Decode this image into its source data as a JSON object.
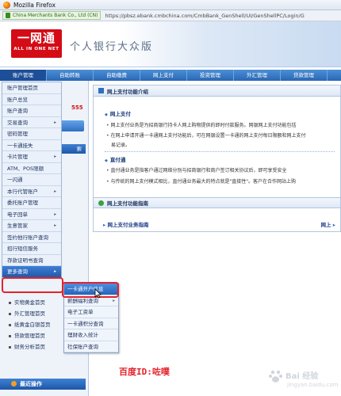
{
  "browser": {
    "window_title": "Mozilla Firefox",
    "site_identity": "China Merchants Bank Co., Ltd (CN)",
    "url": "https://pbsz.ebank.cmbchina.com/CmbBank_GenShell/UI/GenShellPC/Login/G"
  },
  "bank": {
    "logo_cn": "一网通",
    "logo_en": "ALL IN ONE NET",
    "title": "个人银行大众版"
  },
  "topnav": {
    "tabs": [
      {
        "label": "账户管理"
      },
      {
        "label": "自助转账"
      },
      {
        "label": "自助缴费"
      },
      {
        "label": "网上支付"
      },
      {
        "label": "投资管理"
      },
      {
        "label": "外汇管理"
      },
      {
        "label": "贷款管理"
      }
    ]
  },
  "left": {
    "red_digits": "555",
    "collapse_label": "索"
  },
  "menu": {
    "items": [
      {
        "label": "账户管理首页",
        "has_sub": false
      },
      {
        "label": "账户总览",
        "has_sub": false
      },
      {
        "label": "账户查询",
        "has_sub": false
      },
      {
        "label": "交易查询",
        "has_sub": true
      },
      {
        "label": "密码管理",
        "has_sub": false
      },
      {
        "label": "一卡通挂失",
        "has_sub": false
      },
      {
        "label": "卡片管理",
        "has_sub": true
      },
      {
        "label": "ATM、POS限额",
        "has_sub": false
      },
      {
        "label": "一闪通",
        "has_sub": false
      },
      {
        "label": "本行代管账户",
        "has_sub": true
      },
      {
        "label": "委托账户管理",
        "has_sub": false
      },
      {
        "label": "电子回单",
        "has_sub": true
      },
      {
        "label": "生意管家",
        "has_sub": true
      },
      {
        "label": "签约他行账户查询",
        "has_sub": false
      },
      {
        "label": "招行短信服务",
        "has_sub": false
      },
      {
        "label": "存款证明书查询",
        "has_sub": false
      },
      {
        "label": "更多查询",
        "has_sub": true
      }
    ],
    "highlighted": "更多查询"
  },
  "subtree": {
    "items": [
      {
        "label": "实物黄金首页"
      },
      {
        "label": "外汇管理首页"
      },
      {
        "label": "纸黄金白银首页"
      },
      {
        "label": "贷款管理首页"
      },
      {
        "label": "财务分析首页"
      }
    ],
    "recent_label": "最近操作"
  },
  "submenu": {
    "items": [
      {
        "label": "一卡通开户信息",
        "has_sub": false
      },
      {
        "label": "薪酬福利查询",
        "has_sub": true
      },
      {
        "label": "电子工资单",
        "has_sub": false
      },
      {
        "label": "一卡通积分查询",
        "has_sub": false
      },
      {
        "label": "理财收入统计",
        "has_sub": false
      },
      {
        "label": "社保账户查询",
        "has_sub": false
      }
    ],
    "highlighted": "一卡通开户信息"
  },
  "panel": {
    "title": "网上支付功能介绍",
    "section1_title": "网上支付",
    "section1_line1": "网上支付业务是为招商银行持卡人网上购物提供的即时付款服务。网银网上支付功能包括",
    "section1_line2": "在网上申请开通一卡通网上支付功能后，可在网银设置一卡通的网上支付每日限额和网上支付",
    "section1_line2_cont": "易记录。",
    "section2_title": "直付通",
    "section2_line1": "直付通业务是指客户通过网络分别与招商银行和商户签订相关协议后，即可享受安全",
    "section2_line2": "与传统的网上支付模式相比，直付通业务最大的特点就是\"直接性\"。客户在合作网站上购"
  },
  "guide": {
    "title": "网上支付功能指南",
    "link1": "网上支付业务指南",
    "link2": "网上"
  },
  "caption": "百度ID:咗噗",
  "watermark": {
    "text": "Bai 经验",
    "sub": "jingyan.baidu.com"
  },
  "colors": {
    "accent_blue": "#2a67b3",
    "brand_red": "#d40c16",
    "highlight_red": "#e4222b"
  }
}
